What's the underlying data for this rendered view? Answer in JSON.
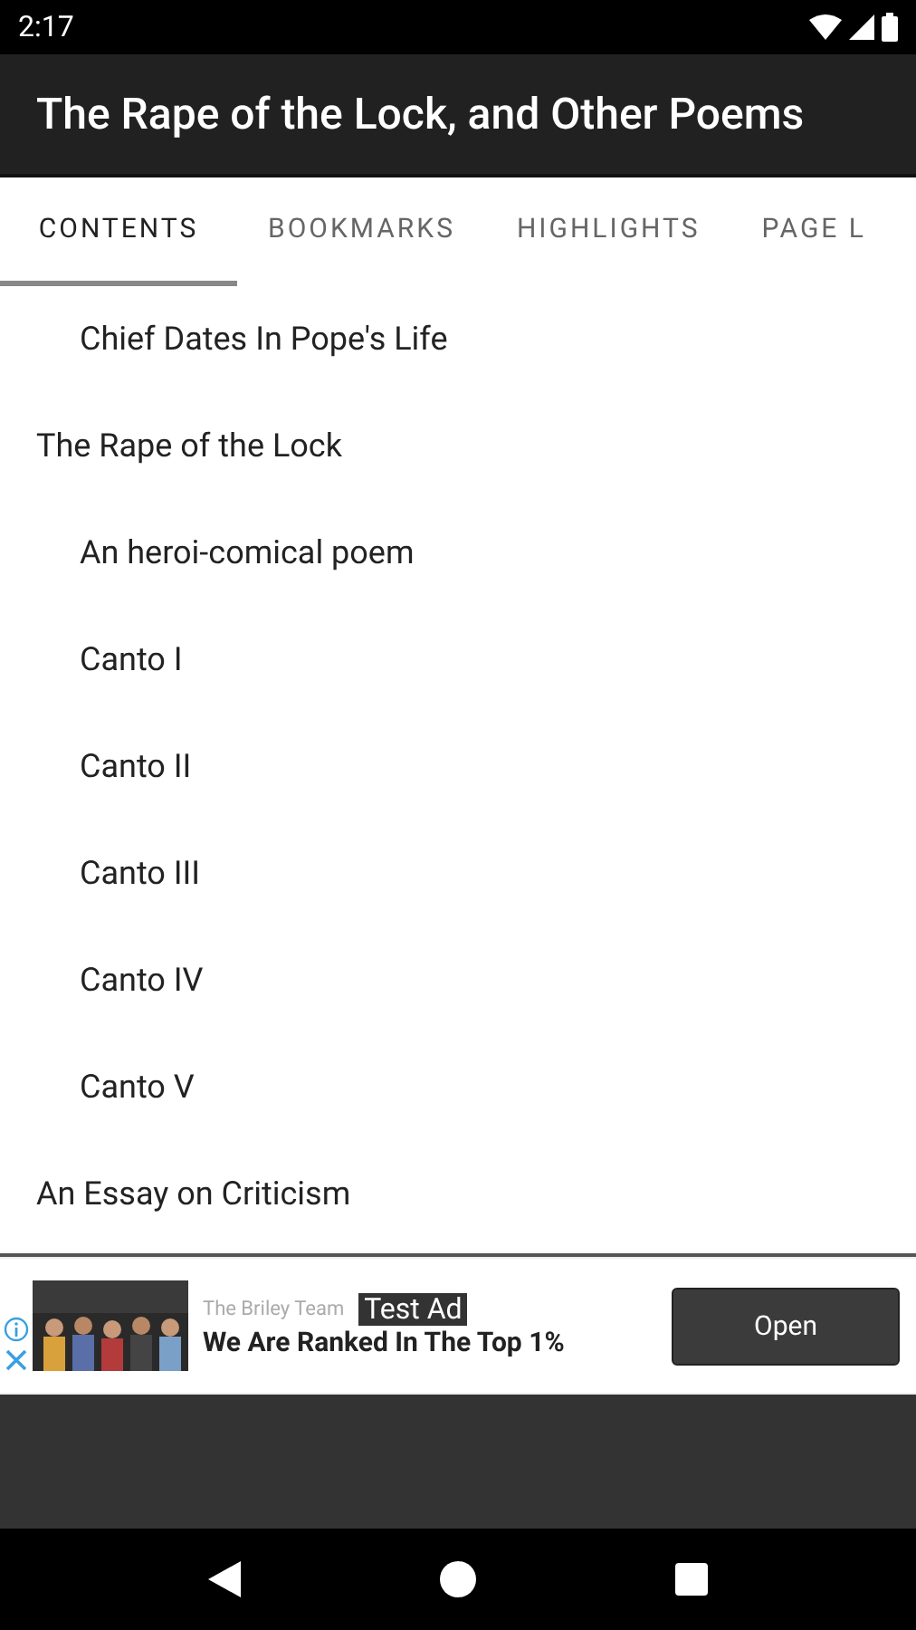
{
  "status_bar": {
    "time": "2:17"
  },
  "app_bar": {
    "title": "The Rape of the Lock, and Other Poems"
  },
  "tabs": [
    {
      "label": "CONTENTS",
      "selected": true
    },
    {
      "label": "BOOKMARKS",
      "selected": false
    },
    {
      "label": "HIGHLIGHTS",
      "selected": false
    },
    {
      "label": "PAGE L",
      "selected": false
    }
  ],
  "contents": [
    {
      "children": [
        {
          "label": "Chief Dates In Pope's Life"
        }
      ]
    },
    {
      "label": "The Rape of the Lock",
      "children": [
        {
          "label": "An heroi-comical poem"
        },
        {
          "label": "Canto I"
        },
        {
          "label": "Canto II"
        },
        {
          "label": "Canto III"
        },
        {
          "label": "Canto IV"
        },
        {
          "label": "Canto V"
        }
      ]
    },
    {
      "label": "An Essay on Criticism"
    }
  ],
  "ad": {
    "kind": "picture",
    "advertiser": "The Briley Team",
    "badge": "Test Ad",
    "headline": "We Are Ranked In The Top 1%",
    "button": "Open"
  }
}
